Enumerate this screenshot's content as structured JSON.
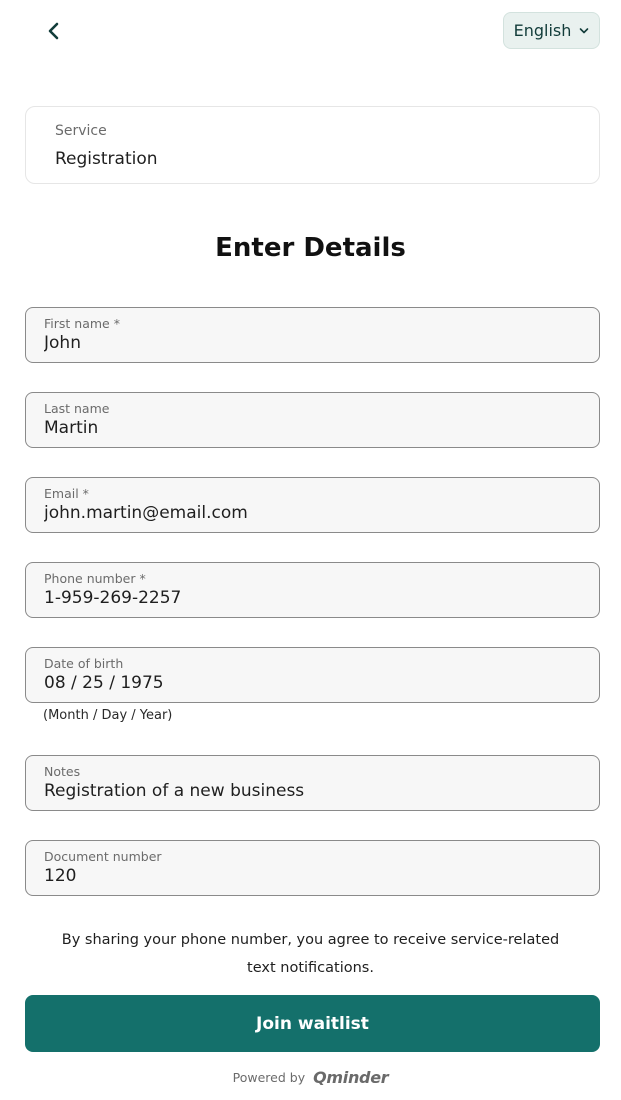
{
  "header": {
    "back_icon": "chevron-left-icon",
    "language": "English",
    "language_icon": "chevron-down-icon"
  },
  "service": {
    "label": "Service",
    "value": "Registration"
  },
  "form": {
    "title": "Enter Details",
    "fields": [
      {
        "label": "First name *",
        "value": "John"
      },
      {
        "label": "Last name",
        "value": "Martin"
      },
      {
        "label": "Email *",
        "value": "john.martin@email.com"
      },
      {
        "label": "Phone number *",
        "value": "1-959-269-2257"
      },
      {
        "label": "Date of birth",
        "value": "08 / 25 / 1975"
      },
      {
        "label": "Notes",
        "value": "Registration of a new business"
      },
      {
        "label": "Document number",
        "value": "120"
      }
    ],
    "dob_hint": "(Month / Day / Year)",
    "consent": "By sharing your phone number, you agree to receive service-related text notifications.",
    "submit_label": "Join waitlist"
  },
  "footer": {
    "powered_by": "Powered by",
    "brand": "Qminder"
  },
  "colors": {
    "accent": "#14706b",
    "language_bg": "#e9f1ef"
  }
}
